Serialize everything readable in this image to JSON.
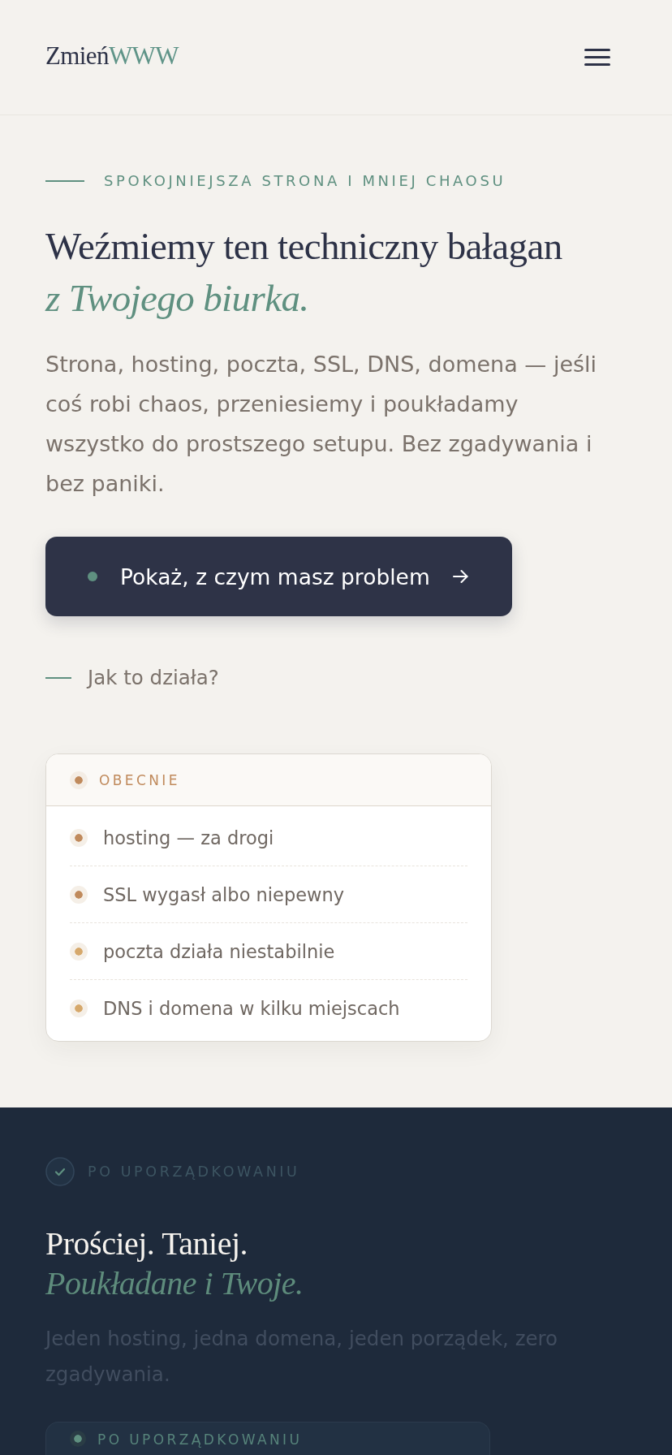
{
  "header": {
    "logo": {
      "primary": "Zmień",
      "accent": "WWW"
    }
  },
  "hero": {
    "eyebrow": "SPOKOJNIEJSZA STRONA I MNIEJ CHAOSU",
    "title": {
      "line_1": "Weźmiemy ten techniczny bałagan",
      "line_2": "z Twojego biurka."
    },
    "lead": "Strona, hosting, poczta, SSL, DNS, domena — jeśli coś robi chaos, przeniesiemy i poukładamy wszystko do prostszego setupu. Bez zgadywania i bez paniki.",
    "cta": {
      "label": "Pokaż, z czym masz problem"
    },
    "secondary_link": {
      "label": "Jak to działa?"
    }
  },
  "current_card": {
    "title": "OBECNIE",
    "items": [
      {
        "text": "hosting — za drogi",
        "color": "#c08a5c"
      },
      {
        "text": "SSL wygasł albo niepewny",
        "color": "#c08a5c"
      },
      {
        "text": "poczta działa niestabilnie",
        "color": "#d6a86b"
      },
      {
        "text": "DNS i domena w kilku miejscach",
        "color": "#d6a86b"
      }
    ]
  },
  "after_section": {
    "eyebrow": "PO UPORZĄDKOWANIU",
    "title": {
      "line_1": "Prościej. Taniej.",
      "line_2": "Poukładane i Twoje."
    },
    "lead": "Jeden hosting, jedna domena, jeden porządek, zero zgadywania.",
    "card": {
      "title": "PO UPORZĄDKOWANIU"
    }
  }
}
